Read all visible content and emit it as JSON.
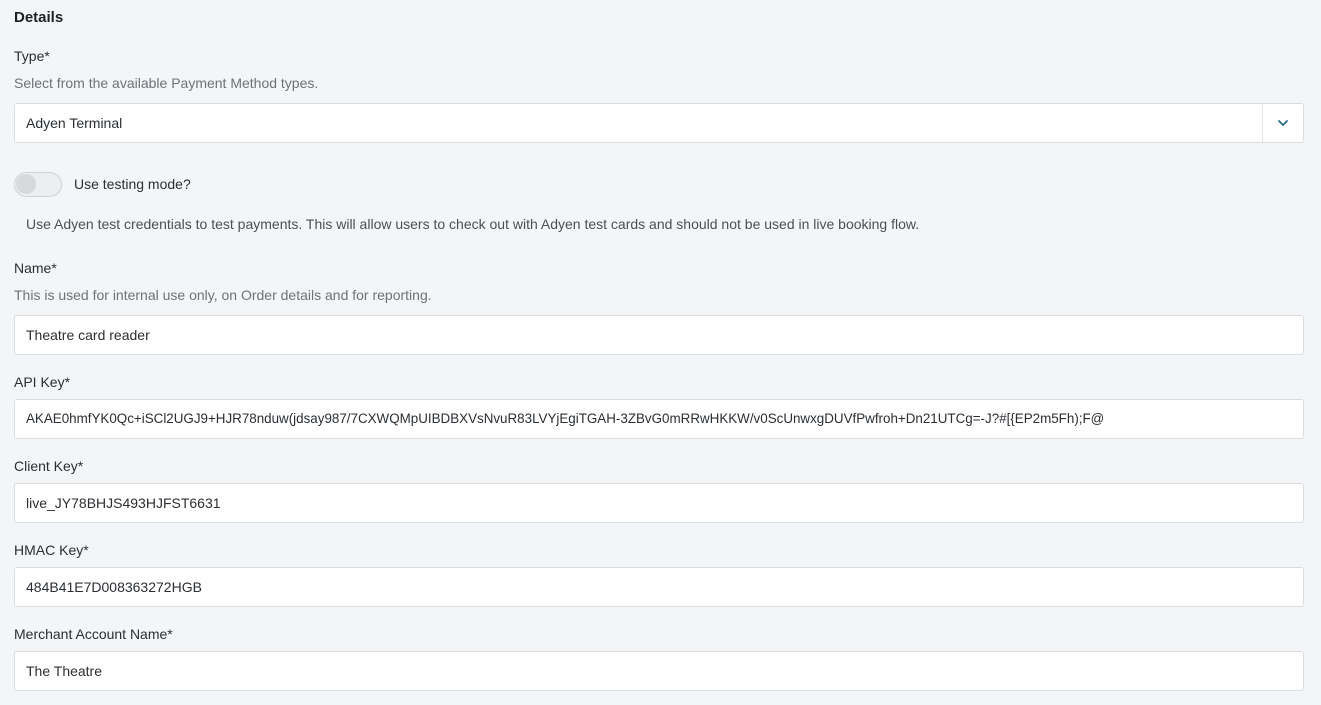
{
  "section": {
    "title": "Details"
  },
  "type": {
    "label": "Type*",
    "help": "Select from the available Payment Method types.",
    "value": "Adyen Terminal"
  },
  "testing_mode": {
    "label": "Use testing mode?",
    "enabled": false,
    "help": "Use Adyen test credentials to test payments. This will allow users to check out with Adyen test cards and should not be used in live booking flow."
  },
  "name": {
    "label": "Name*",
    "help": "This is used for internal use only, on Order details and for reporting.",
    "value": "Theatre card reader"
  },
  "api_key": {
    "label": "API Key*",
    "value": "AKAE0hmfYK0Qc+iSCl2UGJ9+HJR78nduw(jdsay987/7CXWQMpUIBDBXVsNvuR83LVYjEgiTGAH-3ZBvG0mRRwHKKW/v0ScUnwxgDUVfPwfroh+Dn21UTCg=-J?#[{EP2m5Fh);F@"
  },
  "client_key": {
    "label": "Client Key*",
    "value": "live_JY78BHJS493HJFST6631"
  },
  "hmac_key": {
    "label": "HMAC Key*",
    "value": "484B41E7D008363272HGB"
  },
  "merchant_account": {
    "label": "Merchant Account Name*",
    "value": "The Theatre"
  }
}
